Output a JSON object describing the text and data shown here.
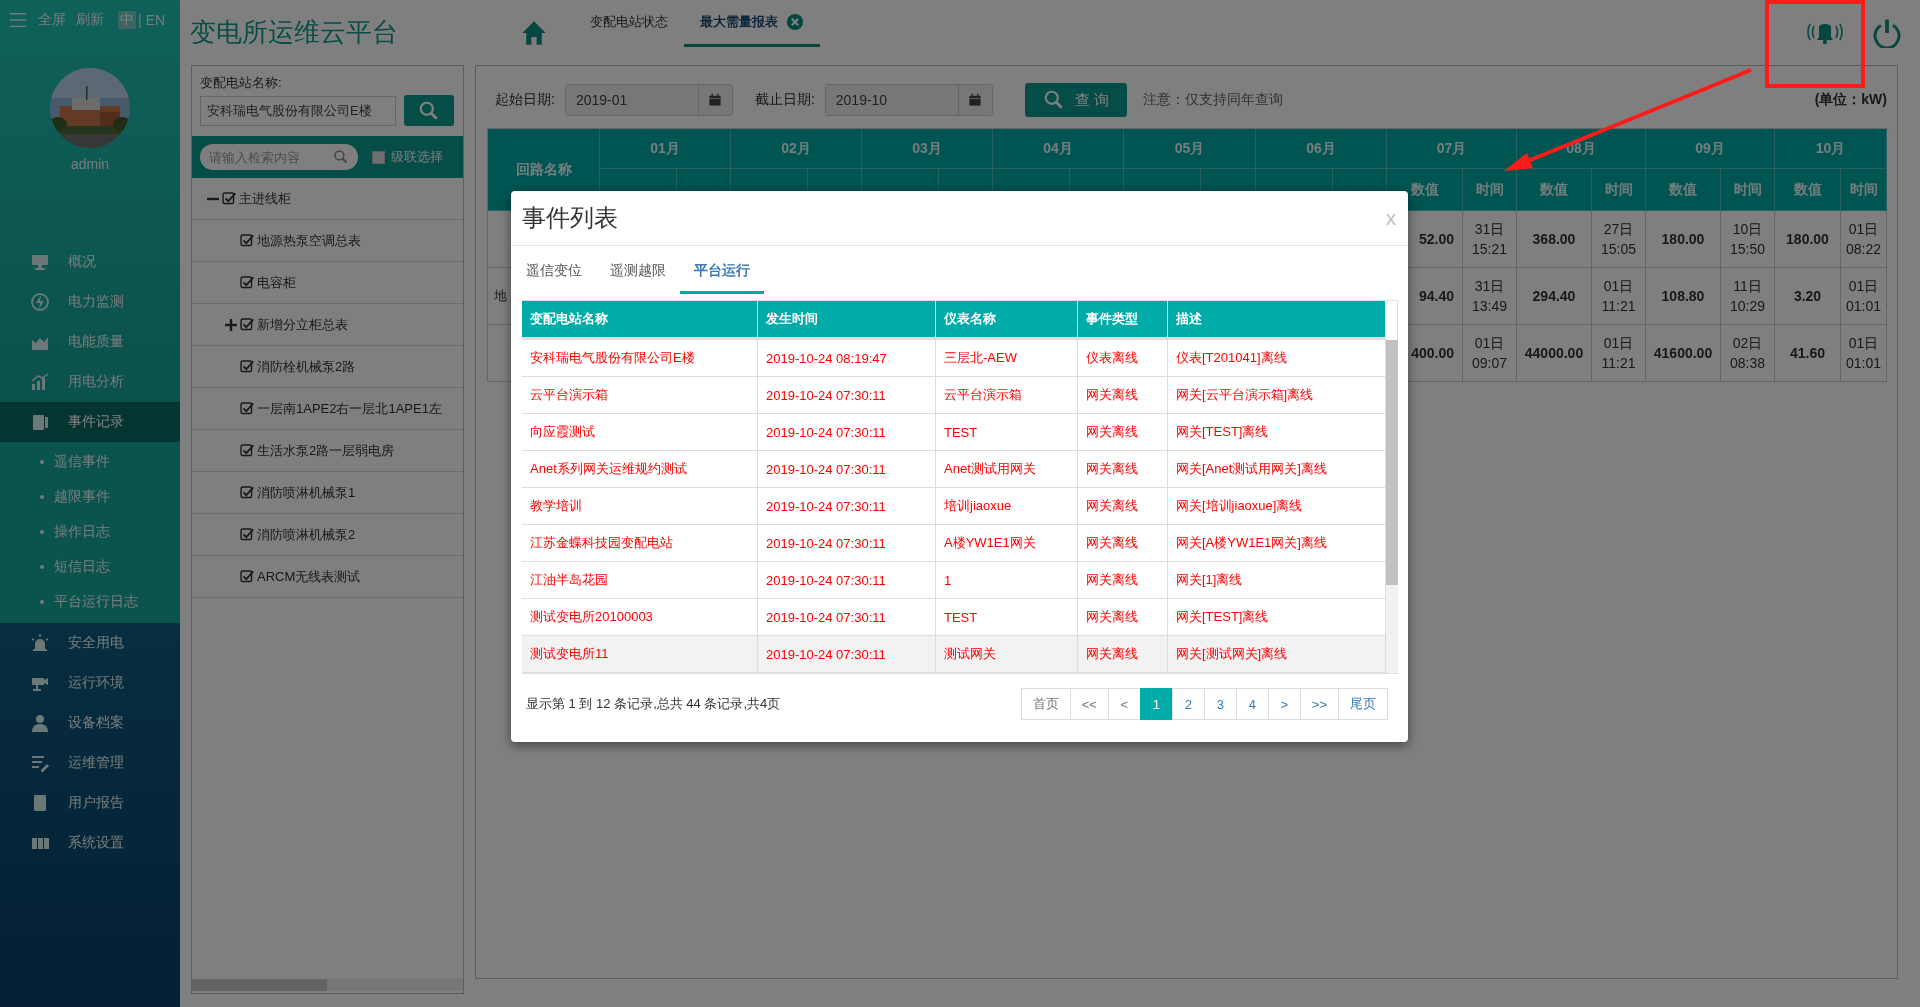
{
  "sidebar": {
    "top_links": [
      "全屏",
      "刷新"
    ],
    "languages": [
      {
        "label": "中",
        "selected": true
      },
      {
        "label": "EN",
        "selected": false
      }
    ],
    "language_separator": "|",
    "user": {
      "name": "admin"
    },
    "menu": [
      {
        "label": "概况",
        "selected": false
      },
      {
        "label": "电力监测",
        "selected": false
      },
      {
        "label": "电能质量",
        "selected": false
      },
      {
        "label": "用电分析",
        "selected": false
      },
      {
        "label": "事件记录",
        "selected": true,
        "expanded": true,
        "children": [
          {
            "label": "遥信事件",
            "selected": false
          },
          {
            "label": "越限事件",
            "selected": false
          },
          {
            "label": "操作日志",
            "selected": false
          },
          {
            "label": "短信日志",
            "selected": false
          },
          {
            "label": "平台运行日志",
            "selected": false
          }
        ]
      },
      {
        "label": "安全用电",
        "selected": false
      },
      {
        "label": "运行环境",
        "selected": false
      },
      {
        "label": "设备档案",
        "selected": false
      },
      {
        "label": "运维管理",
        "selected": false
      },
      {
        "label": "用户报告",
        "selected": false
      },
      {
        "label": "系统设置",
        "selected": false
      }
    ]
  },
  "header": {
    "title": "变电所运维云平台",
    "tabs": [
      {
        "label": "变配电站状态",
        "selected": false,
        "closable": false
      },
      {
        "label": "最大需量报表",
        "selected": true,
        "closable": true
      }
    ]
  },
  "tree_panel": {
    "station_label": "变配电站名称:",
    "station_value": "安科瑞电气股份有限公司E楼",
    "search": {
      "placeholder": "请输入检索内容"
    },
    "cascade": {
      "label": "级联选择",
      "checked": false
    },
    "tree": [
      {
        "label": "主进线柜",
        "checked": true,
        "expanded": true,
        "children": [
          {
            "label": "地源热泵空调总表",
            "checked": true
          },
          {
            "label": "电容柜",
            "checked": true
          },
          {
            "label": "新增分立柜总表",
            "checked": true,
            "expanded": false
          },
          {
            "label": "消防栓机械泵2路",
            "checked": true
          },
          {
            "label": "一层南1APE2右一层北1APE1左",
            "checked": true
          },
          {
            "label": "生活水泵2路一层弱电房",
            "checked": true
          },
          {
            "label": "消防喷淋机械泵1",
            "checked": true
          },
          {
            "label": "消防喷淋机械泵2",
            "checked": true
          },
          {
            "label": "ARCM无线表测试",
            "checked": true
          }
        ]
      }
    ]
  },
  "report": {
    "start_label": "起始日期:",
    "start_value": "2019-01",
    "end_label": "截止日期:",
    "end_value": "2019-10",
    "query_button": "查 询",
    "note": "注意：仅支持同年查询",
    "unit": "(单位：kW)",
    "table": {
      "name_header": "回路名称",
      "months": [
        "01月",
        "02月",
        "03月",
        "04月",
        "05月",
        "06月",
        "07月",
        "08月",
        "09月",
        "10月"
      ],
      "sub_headers": [
        "数值",
        "时间",
        "数值",
        "时间",
        "数值",
        "时间",
        "数值",
        "时间"
      ],
      "rows": [
        {
          "cells": [
            "52.00",
            "31日\n15:21",
            "368.00",
            "27日\n15:05",
            "180.00",
            "10日\n15:50",
            "180.00",
            "01日\n08:22"
          ]
        },
        {
          "name": "地",
          "cells": [
            "94.40",
            "31日\n13:49",
            "294.40",
            "01日\n11:21",
            "108.80",
            "11日\n10:29",
            "3.20",
            "01日\n01:01"
          ]
        },
        {
          "cells": [
            "400.00",
            "01日\n09:07",
            "44000.00",
            "01日\n11:21",
            "41600.00",
            "02日\n08:38",
            "41.60",
            "01日\n01:01"
          ]
        }
      ]
    }
  },
  "modal": {
    "title": "事件列表",
    "close": "x",
    "tabs": [
      {
        "label": "遥信变位",
        "selected": false
      },
      {
        "label": "遥测越限",
        "selected": false
      },
      {
        "label": "平台运行",
        "selected": true
      }
    ],
    "table": {
      "columns": [
        "变配电站名称",
        "发生时间",
        "仪表名称",
        "事件类型",
        "描述"
      ],
      "rows": [
        {
          "cells": [
            "安科瑞电气股份有限公司E楼",
            "2019-10-24 08:19:47",
            "三层北-AEW",
            "仪表离线",
            "仪表[T201041]离线"
          ],
          "hovered": false
        },
        {
          "cells": [
            "云平台演示箱",
            "2019-10-24 07:30:11",
            "云平台演示箱",
            "网关离线",
            "网关[云平台演示箱]离线"
          ],
          "hovered": false
        },
        {
          "cells": [
            "向应霞测试",
            "2019-10-24 07:30:11",
            "TEST",
            "网关离线",
            "网关[TEST]离线"
          ],
          "hovered": false
        },
        {
          "cells": [
            "Anet系列网关运维规约测试",
            "2019-10-24 07:30:11",
            "Anet测试用网关",
            "网关离线",
            "网关[Anet测试用网关]离线"
          ],
          "hovered": false
        },
        {
          "cells": [
            "教学培训",
            "2019-10-24 07:30:11",
            "培训jiaoxue",
            "网关离线",
            "网关[培训jiaoxue]离线"
          ],
          "hovered": false
        },
        {
          "cells": [
            "江苏金蝶科技园变配电站",
            "2019-10-24 07:30:11",
            "A楼YW1E1网关",
            "网关离线",
            "网关[A楼YW1E1网关]离线"
          ],
          "hovered": false
        },
        {
          "cells": [
            "江油半岛花园",
            "2019-10-24 07:30:11",
            "1",
            "网关离线",
            "网关[1]离线"
          ],
          "hovered": false
        },
        {
          "cells": [
            "测试变电所20100003",
            "2019-10-24 07:30:11",
            "TEST",
            "网关离线",
            "网关[TEST]离线"
          ],
          "hovered": false
        },
        {
          "cells": [
            "测试变电所11",
            "2019-10-24 07:30:11",
            "测试网关",
            "网关离线",
            "网关[测试网关]离线"
          ],
          "hovered": true
        }
      ]
    },
    "summary": "显示第 1 到 12 条记录,总共 44 条记录,共4页",
    "pagination": [
      {
        "label": "首页",
        "selected": false,
        "disabled": true
      },
      {
        "label": "<<",
        "selected": false,
        "disabled": true
      },
      {
        "label": "<",
        "selected": false,
        "disabled": true
      },
      {
        "label": "1",
        "selected": true,
        "disabled": false
      },
      {
        "label": "2",
        "selected": false,
        "disabled": false
      },
      {
        "label": "3",
        "selected": false,
        "disabled": false
      },
      {
        "label": "4",
        "selected": false,
        "disabled": false
      },
      {
        "label": ">",
        "selected": false,
        "disabled": false
      },
      {
        "label": ">>",
        "selected": false,
        "disabled": false
      },
      {
        "label": "尾页",
        "selected": false,
        "disabled": false
      }
    ]
  }
}
